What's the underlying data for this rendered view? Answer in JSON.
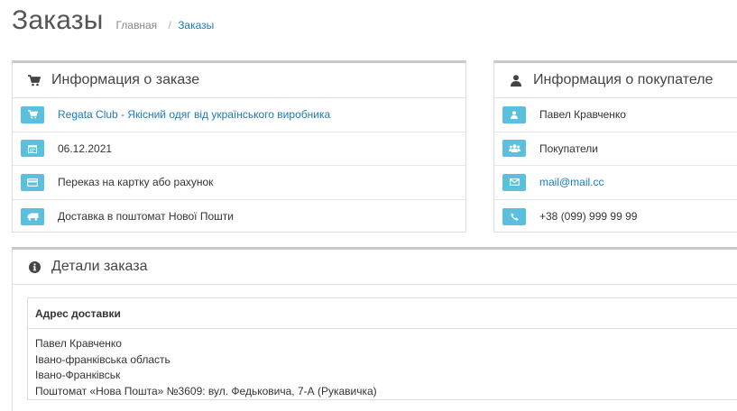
{
  "page": {
    "title": "Заказы"
  },
  "breadcrumb": {
    "home": "Главная",
    "separator": "/",
    "current": "Заказы"
  },
  "order_info": {
    "title": "Информация о заказе",
    "icon": "cart-icon",
    "rows": [
      {
        "icon": "cart-icon",
        "text": "Regata Club - Якісний одяг від українського виробника",
        "link": true
      },
      {
        "icon": "calendar-icon",
        "text": "06.12.2021",
        "link": false
      },
      {
        "icon": "credit-card-icon",
        "text": "Переказ на картку або рахунок",
        "link": false
      },
      {
        "icon": "truck-icon",
        "text": "Доставка в поштомат Нової Пошти",
        "link": false
      }
    ]
  },
  "customer_info": {
    "title": "Информация о покупателе",
    "icon": "user-icon",
    "rows": [
      {
        "icon": "user-icon",
        "text": "Павел Кравченко",
        "link": false
      },
      {
        "icon": "users-icon",
        "text": "Покупатели",
        "link": false
      },
      {
        "icon": "envelope-icon",
        "text": "mail@mail.cc",
        "link": true
      },
      {
        "icon": "phone-icon",
        "text": "+38 (099) 999 99 99",
        "link": false
      }
    ]
  },
  "order_details": {
    "title": "Детали заказа",
    "icon": "info-circle-icon",
    "address": {
      "heading": "Адрес доставки",
      "lines": [
        "Павел Кравченко",
        "Івано-франківська область",
        "Івано-Франківськ",
        "Поштомат «Нова Пошта» №3609: вул. Федьковича, 7-А (Рукавичка)"
      ]
    }
  },
  "colors": {
    "accent": "#5bc0de",
    "link": "#1e7ab8",
    "panel_border": "#c9c9c9"
  }
}
